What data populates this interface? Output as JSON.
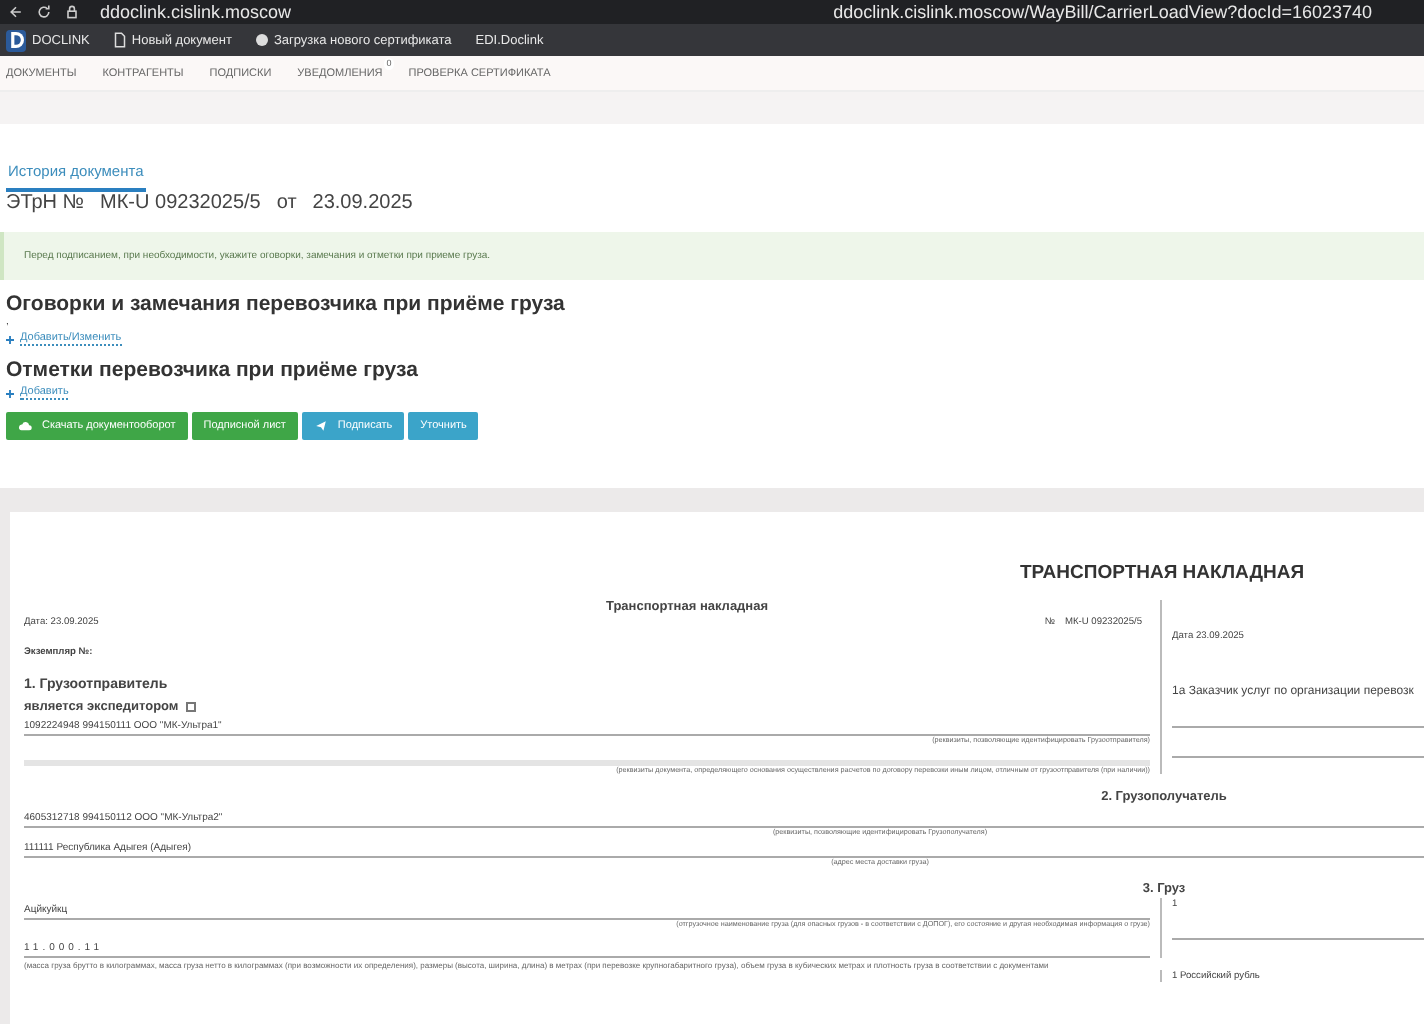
{
  "browser": {
    "host": "ddoclink.cislink.moscow",
    "address": "ddoclink.cislink.moscow/WayBill/CarrierLoadView?docId=16023740"
  },
  "bookmarks": [
    {
      "label": "DOCLINK",
      "kind": "logo"
    },
    {
      "label": "Новый документ",
      "kind": "page"
    },
    {
      "label": "Загрузка нового сертификата",
      "kind": "dot"
    },
    {
      "label": "EDI.Doclink",
      "kind": "plain"
    }
  ],
  "nav": [
    {
      "label": "ДОКУМЕНТЫ"
    },
    {
      "label": "КОНТРАГЕНТЫ"
    },
    {
      "label": "ПОДПИСКИ"
    },
    {
      "label": "УВЕДОМЛЕНИЯ",
      "badge": "0"
    },
    {
      "label": "ПРОВЕРКА СЕРТИФИКАТА"
    }
  ],
  "tabs": [
    {
      "label": "История документа",
      "selected": true
    }
  ],
  "title": {
    "type": "ЭТрН №",
    "number": "МК-U 09232025/5",
    "from": "от",
    "date": "23.09.2025"
  },
  "notice": "Перед подписанием, при необходимости, укажите оговорки, замечания и отметки при приеме груза.",
  "sections": [
    {
      "heading": "Оговорки и замечания перевозчика при приёме груза",
      "note": ",",
      "link": "Добавить/Изменить"
    },
    {
      "heading": "Отметки перевозчика при приёме груза",
      "link": "Добавить"
    }
  ],
  "actions": [
    {
      "label": "Скачать документооборот",
      "kind": "download"
    },
    {
      "label": "Подписной лист",
      "kind": "sheet"
    },
    {
      "label": "Подписать",
      "kind": "sign"
    },
    {
      "label": "Уточнить",
      "kind": "clarify"
    }
  ],
  "document": {
    "banner": "ТРАНСПОРТНАЯ НАКЛАДНАЯ",
    "form_title": "Транспортная накладная",
    "date_left": "Дата: 23.09.2025",
    "number_label": "№",
    "number": "МК-U 09232025/5",
    "date_right": "Дата 23.09.2025",
    "copy": "Экземпляр №:",
    "shipper_heading": "1. Грузоотправитель",
    "forwarder_label": "является экспедитором",
    "forwarder_checked": false,
    "shipper_value": "1092224948 994150111 ООО \"МК-Ультра1\"",
    "shipper_caption": "(реквизиты, позволяющие идентифицировать Грузоотправителя)",
    "customer_heading": "1а Заказчик услуг по организации перевозк",
    "payment_caption": "(реквизиты документа, определяющего основания осуществления расчетов по договору перевозки иным лицом, отличным от грузоотправителя (при наличии))",
    "consignee_heading": "2. Грузополучатель",
    "consignee_value": "4605312718 994150112 ООО \"МК-Ультра2\"",
    "consignee_caption": "(реквизиты, позволяющие идентифицировать Грузополучателя)",
    "address_value": "111111 Республика Адыгея (Адыгея)",
    "address_caption": "(адрес места доставки груза)",
    "cargo_heading": "3. Груз",
    "cargo_name": "Ацйкуйкц",
    "cargo_caption": "(отгрузочное наименование груза (для опасных грузов - в соответствии с ДОПОГ), его состояние и другая необходимая информация о грузе)",
    "cargo_count": "1",
    "weight": "11.000.11",
    "weight_caption": "(масса груза брутто в килограммах, масса груза нетто в килограммах (при возможности их определения), размеры (высота, ширина, длина) в метрах (при перевозке крупногабаритного груза), объем груза в кубических метрах и плотность груза в соответствии с документами",
    "currency": "1 Российский рубль"
  }
}
